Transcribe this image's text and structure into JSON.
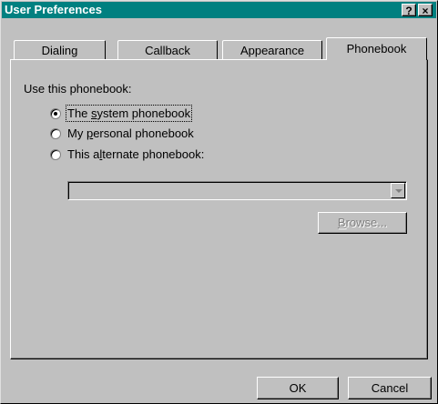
{
  "window": {
    "title": "User Preferences",
    "help_glyph": "?",
    "close_glyph": "×"
  },
  "tabs": [
    {
      "label": "Dialing",
      "active": false
    },
    {
      "label": "Callback",
      "active": false
    },
    {
      "label": "Appearance",
      "active": false
    },
    {
      "label": "Phonebook",
      "active": true
    }
  ],
  "phonebook": {
    "group_label": "Use this phonebook:",
    "options": [
      {
        "pre": "The ",
        "mnemonic": "s",
        "post": "ystem phonebook",
        "selected": true
      },
      {
        "pre": "My ",
        "mnemonic": "p",
        "post": "ersonal phonebook",
        "selected": false
      },
      {
        "pre": "This a",
        "mnemonic": "l",
        "post": "ternate phonebook:",
        "selected": false
      }
    ],
    "alternate_path": {
      "value": "",
      "enabled": false
    },
    "browse": {
      "mnemonic": "B",
      "post": "rowse...",
      "enabled": false
    }
  },
  "buttons": {
    "ok": "OK",
    "cancel": "Cancel"
  }
}
